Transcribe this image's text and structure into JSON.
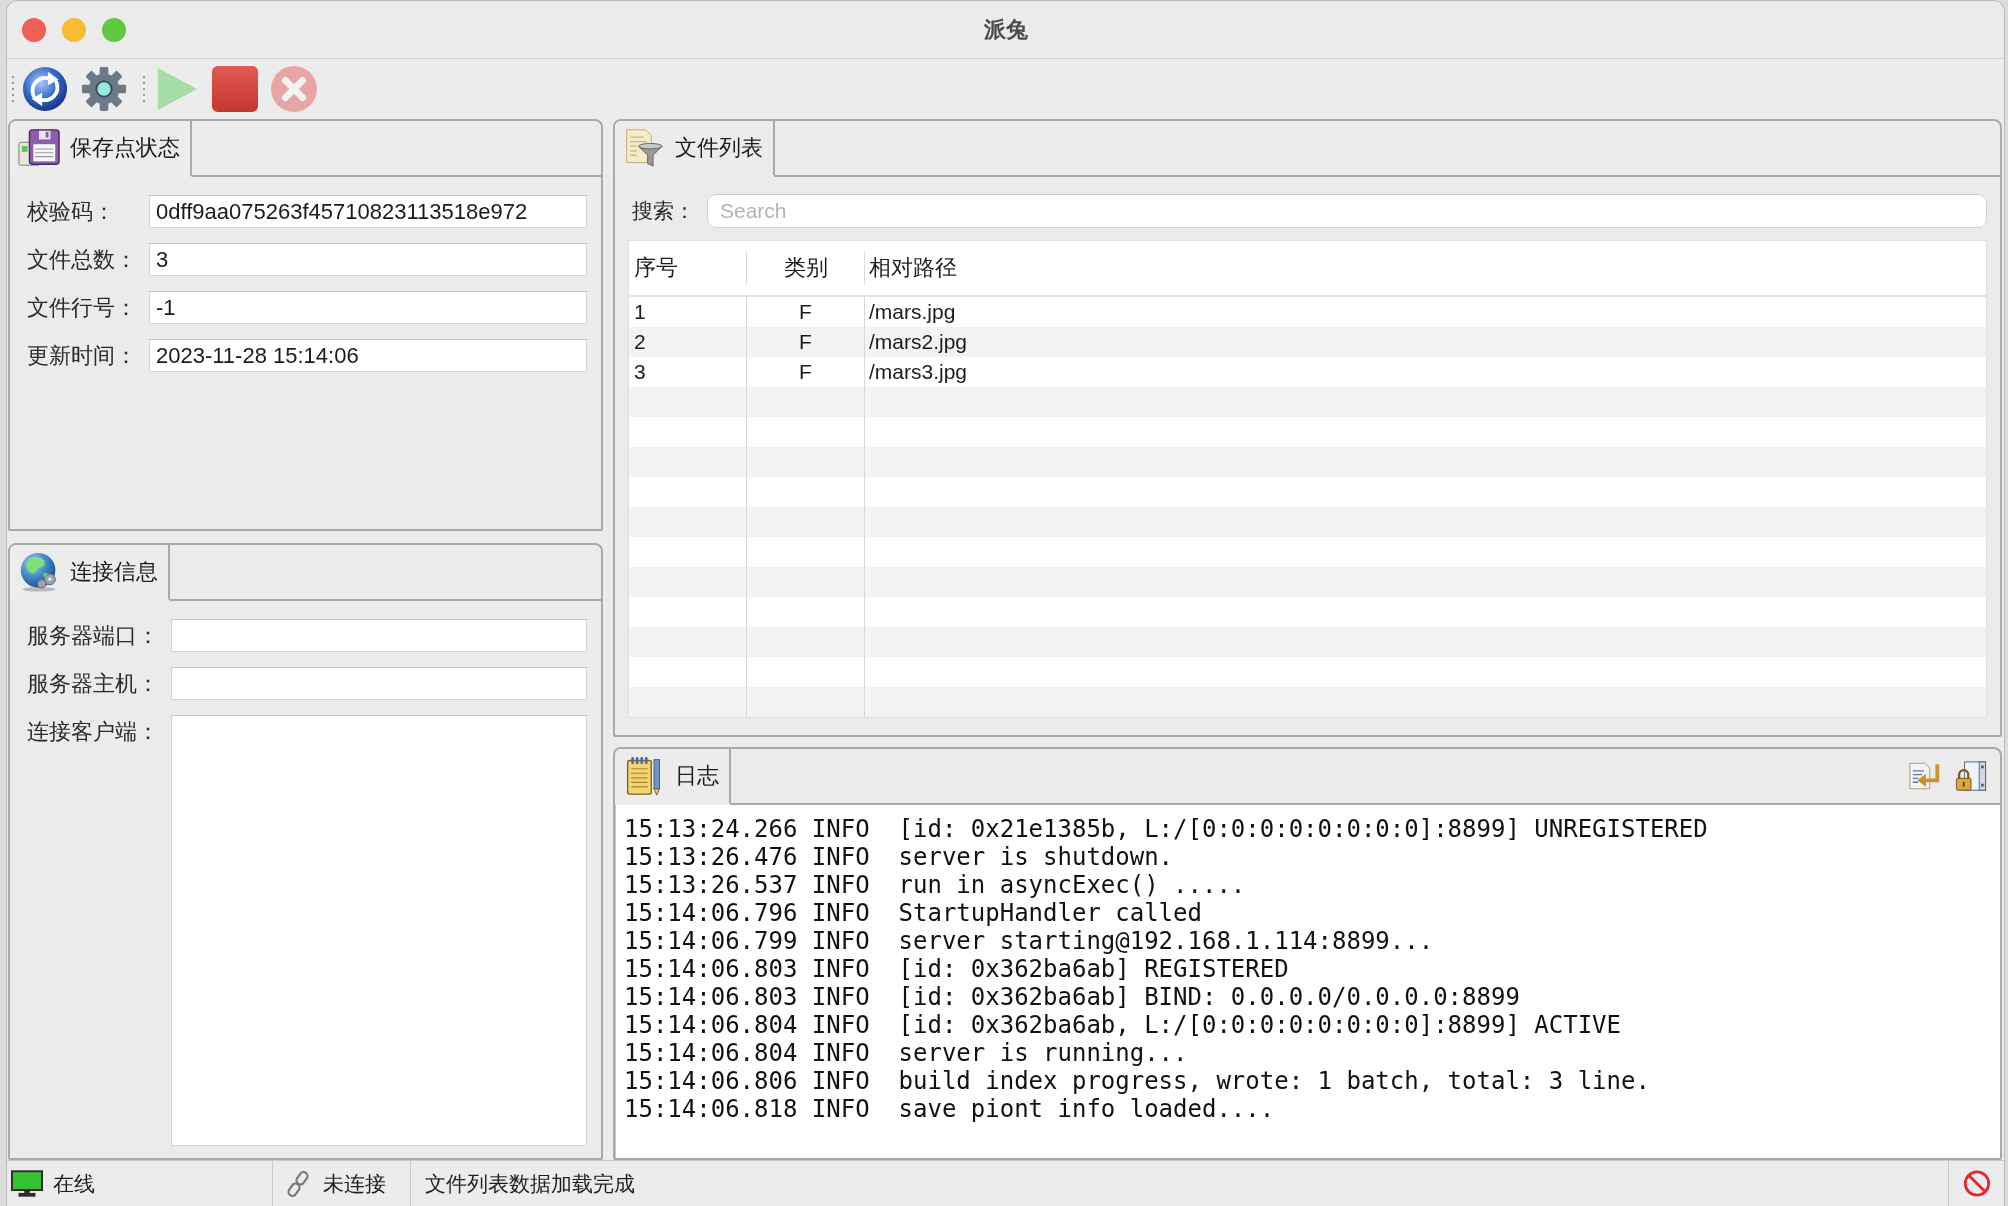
{
  "window": {
    "title": "派兔"
  },
  "toolbar": {
    "groups": [
      [
        {
          "kind": "refresh",
          "disabled": false
        },
        {
          "kind": "settings",
          "disabled": false
        }
      ],
      [
        {
          "kind": "start",
          "disabled": true
        },
        {
          "kind": "stop",
          "disabled": false
        },
        {
          "kind": "close",
          "disabled": true
        }
      ]
    ]
  },
  "save_point_panel": {
    "tab": {
      "label": "保存点状态",
      "selected": true
    },
    "fields": [
      {
        "label": "校验码：",
        "value": "0dff9aa075263f45710823113518e972"
      },
      {
        "label": "文件总数：",
        "value": "3"
      },
      {
        "label": "文件行号：",
        "value": "-1"
      },
      {
        "label": "更新时间：",
        "value": "2023-11-28 15:14:06"
      }
    ]
  },
  "connection_panel": {
    "tab": {
      "label": "连接信息",
      "selected": true
    },
    "fields": [
      {
        "label": "服务器端口：",
        "kind": "input"
      },
      {
        "label": "服务器主机：",
        "kind": "input"
      },
      {
        "label": "连接客户端：",
        "kind": "textarea"
      }
    ]
  },
  "file_list_panel": {
    "tab": {
      "label": "文件列表",
      "selected": true
    },
    "search": {
      "label": "搜索：",
      "placeholder": "Search"
    },
    "table": {
      "columns": [
        "序号",
        "类别",
        "相对路径"
      ],
      "rows": [
        [
          "1",
          "F",
          "/mars.jpg"
        ],
        [
          "2",
          "F",
          "/mars2.jpg"
        ],
        [
          "3",
          "F",
          "/mars3.jpg"
        ]
      ]
    }
  },
  "log_panel": {
    "tab": {
      "label": "日志",
      "selected": true
    },
    "lines": [
      "15:13:24.266 INFO  [id: 0x21e1385b, L:/[0:0:0:0:0:0:0:0]:8899] UNREGISTERED",
      "15:13:26.476 INFO  server is shutdown.",
      "15:13:26.537 INFO  run in asyncExec() .....",
      "15:14:06.796 INFO  StartupHandler called",
      "15:14:06.799 INFO  server starting@192.168.1.114:8899...",
      "15:14:06.803 INFO  [id: 0x362ba6ab] REGISTERED",
      "15:14:06.803 INFO  [id: 0x362ba6ab] BIND: 0.0.0.0/0.0.0.0:8899",
      "15:14:06.804 INFO  [id: 0x362ba6ab, L:/[0:0:0:0:0:0:0:0]:8899] ACTIVE",
      "15:14:06.804 INFO  server is running...",
      "15:14:06.806 INFO  build index progress, wrote: 1 batch, total: 3 line.",
      "15:14:06.818 INFO  save piont info loaded...."
    ]
  },
  "status_bar": {
    "items": [
      {
        "kind": "online",
        "label": "在线"
      },
      {
        "kind": "disconnected",
        "label": "未连接"
      },
      {
        "kind": "message",
        "label": "文件列表数据加载完成"
      }
    ]
  }
}
